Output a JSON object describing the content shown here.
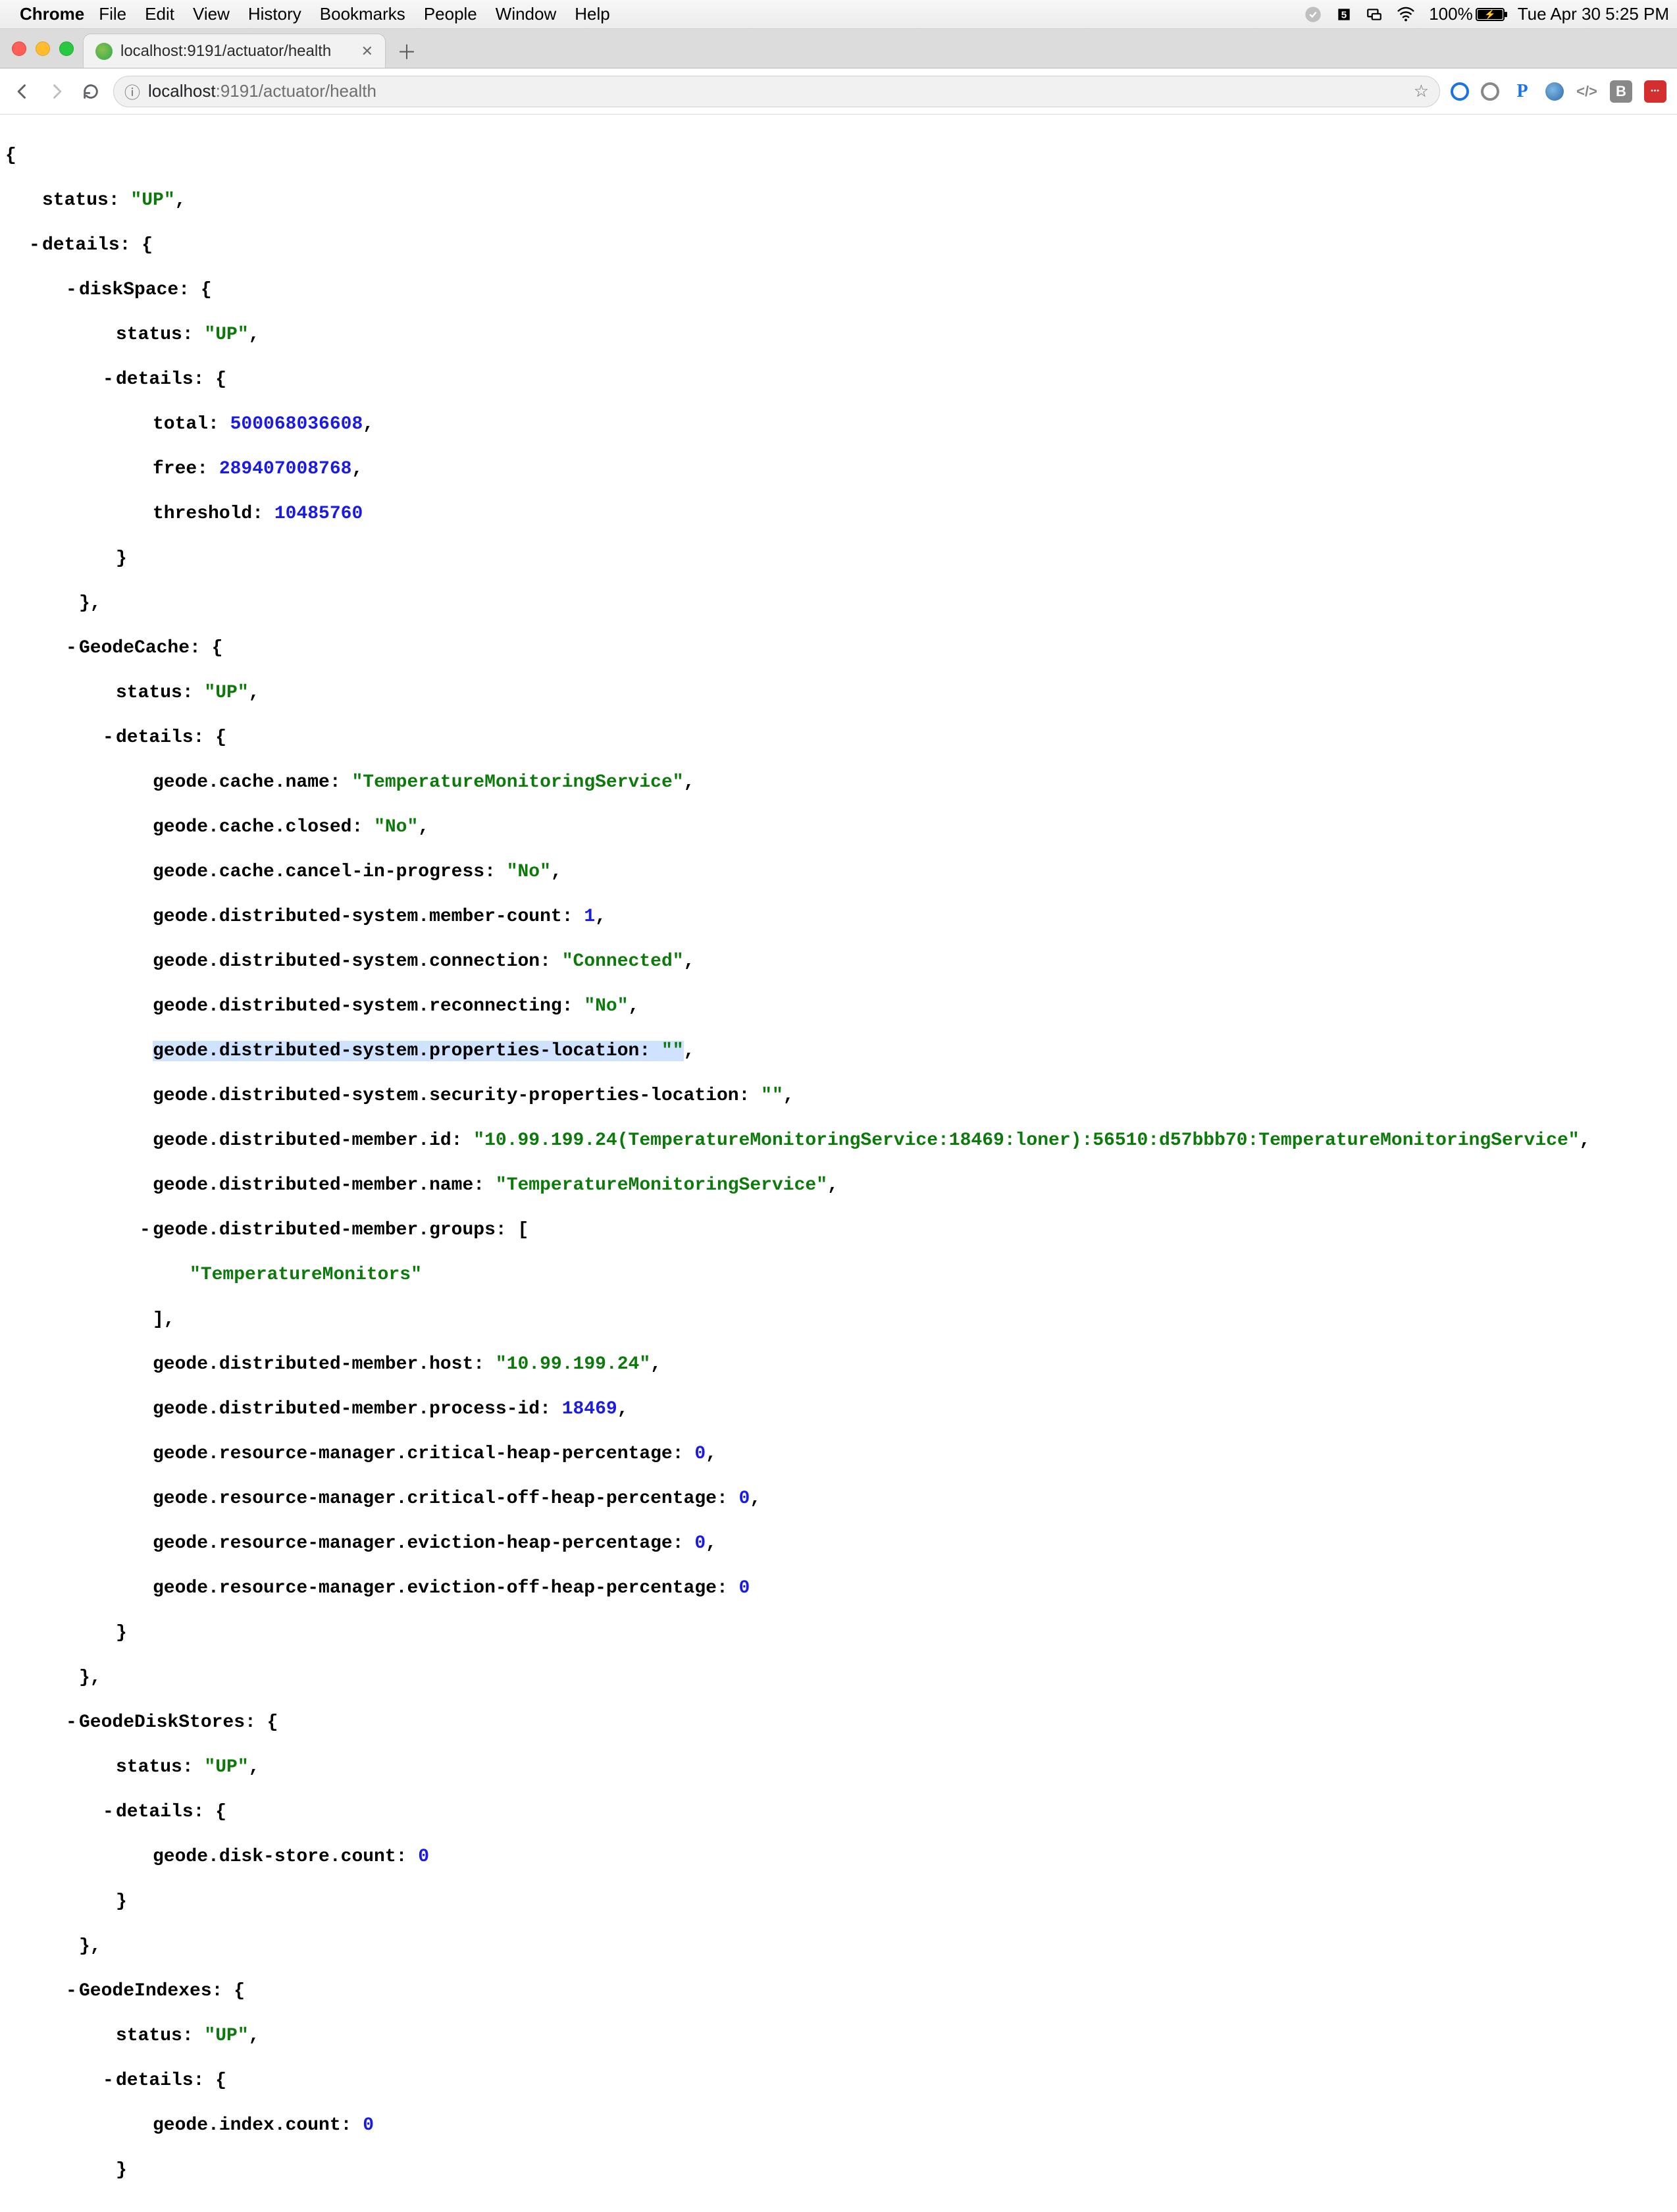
{
  "menubar": {
    "app": "Chrome",
    "items": [
      "File",
      "Edit",
      "View",
      "History",
      "Bookmarks",
      "People",
      "Window",
      "Help"
    ],
    "battery_pct": "100%",
    "clock": "Tue Apr 30  5:25 PM"
  },
  "tab": {
    "title": "localhost:9191/actuator/health"
  },
  "omnibox": {
    "host": "localhost",
    "port_path": ":9191/actuator/health"
  },
  "json": {
    "status": "UP",
    "details": {
      "diskSpace": {
        "status": "UP",
        "details": {
          "total": 500068036608,
          "free": 289407008768,
          "threshold": 10485760
        }
      },
      "GeodeCache": {
        "status": "UP",
        "details": {
          "geode.cache.name": "TemperatureMonitoringService",
          "geode.cache.closed": "No",
          "geode.cache.cancel-in-progress": "No",
          "geode.distributed-system.member-count": 1,
          "geode.distributed-system.connection": "Connected",
          "geode.distributed-system.reconnecting": "No",
          "geode.distributed-system.properties-location": "",
          "geode.distributed-system.security-properties-location": "",
          "geode.distributed-member.id": "10.99.199.24(TemperatureMonitoringService:18469:loner):56510:d57bbb70:TemperatureMonitoringService",
          "geode.distributed-member.name": "TemperatureMonitoringService",
          "geode.distributed-member.groups": [
            "TemperatureMonitors"
          ],
          "geode.distributed-member.host": "10.99.199.24",
          "geode.distributed-member.process-id": 18469,
          "geode.resource-manager.critical-heap-percentage": 0,
          "geode.resource-manager.critical-off-heap-percentage": 0,
          "geode.resource-manager.eviction-heap-percentage": 0,
          "geode.resource-manager.eviction-off-heap-percentage": 0
        }
      },
      "GeodeDiskStores": {
        "status": "UP",
        "details": {
          "geode.disk-store.count": 0
        }
      },
      "GeodeIndexes": {
        "status": "UP",
        "details": {
          "geode.index.count": 0
        }
      }
    }
  }
}
